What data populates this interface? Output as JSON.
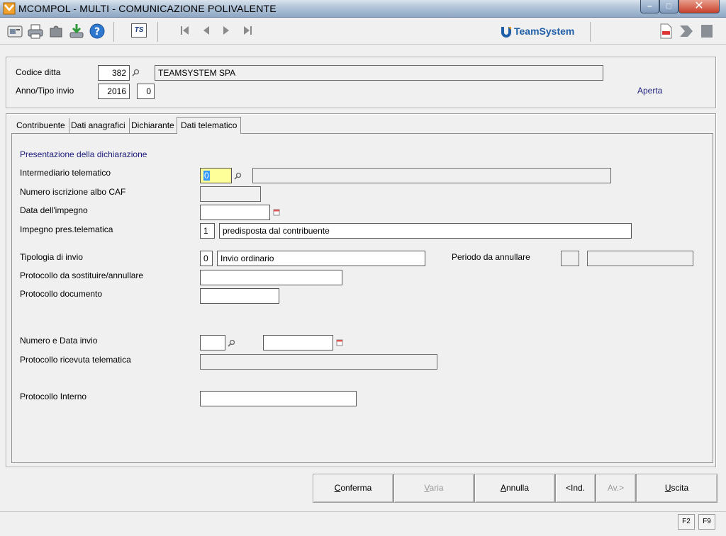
{
  "window": {
    "title": "MCOMPOL  - MULTI -  COMUNICAZIONE POLIVALENTE",
    "minimize": "–",
    "maximize": "□",
    "close": "✕"
  },
  "toolbar": {
    "brand": "TeamSystem",
    "ts_label": "TS",
    "icons": [
      "card-icon",
      "print-icon",
      "puzzle-icon",
      "download-icon",
      "help-icon",
      "ts-icon",
      "first-icon",
      "prev-icon",
      "next-icon",
      "last-icon",
      "pdf-icon",
      "forward-icon",
      "page-icon"
    ]
  },
  "header": {
    "codice_ditta_label": "Codice ditta",
    "codice_ditta_value": "382",
    "company_name": "TEAMSYSTEM SPA",
    "anno_tipo_label": "Anno/Tipo invio",
    "anno_value": "2016",
    "tipo_value": "0",
    "status": "Aperta"
  },
  "tabs": [
    {
      "label": "Contribuente",
      "active": false
    },
    {
      "label": "Dati anagrafici",
      "active": false
    },
    {
      "label": "Dichiarante",
      "active": false
    },
    {
      "label": "Dati telematico",
      "active": true
    }
  ],
  "form": {
    "section_title": "Presentazione della dichiarazione",
    "intermediario_label": "Intermediario telematico",
    "intermediario_value": "0",
    "intermediario_desc": "",
    "numero_caf_label": "Numero iscrizione albo CAF",
    "numero_caf_value": "",
    "data_impegno_label": "Data dell'impegno",
    "data_impegno_value": "",
    "impegno_label": "Impegno pres.telematica",
    "impegno_code": "1",
    "impegno_desc": "predisposta dal contribuente",
    "tipologia_label": "Tipologia di invio",
    "tipologia_code": "0",
    "tipologia_desc": "Invio ordinario",
    "periodo_label": "Periodo da annullare",
    "periodo_value": "",
    "periodo_desc": "",
    "protocollo_sost_label": "Protocollo da sostituire/annullare",
    "protocollo_sost_value": "",
    "protocollo_doc_label": "Protocollo documento",
    "protocollo_doc_value": "",
    "numero_data_label": "Numero e Data invio",
    "numero_invio_value": "",
    "data_invio_value": "",
    "ricevuta_label": "Protocollo ricevuta telematica",
    "ricevuta_value": "",
    "interno_label": "Protocollo Interno",
    "interno_value": ""
  },
  "buttons": {
    "conferma_pre": "",
    "conferma_u": "C",
    "conferma_post": "onferma",
    "varia_pre": "",
    "varia_u": "V",
    "varia_post": "aria",
    "annulla_pre": "",
    "annulla_u": "A",
    "annulla_post": "nnulla",
    "ind": "<Ind.",
    "av": "Av.>",
    "uscita_pre": "",
    "uscita_u": "U",
    "uscita_post": "scita"
  },
  "fkeys": [
    "F2",
    "F9"
  ],
  "colors": {
    "focus_field": "#ffff99",
    "status_text": "#1c1c7a",
    "brand_blue": "#1f5fa8",
    "close_button": "#c8402b"
  }
}
